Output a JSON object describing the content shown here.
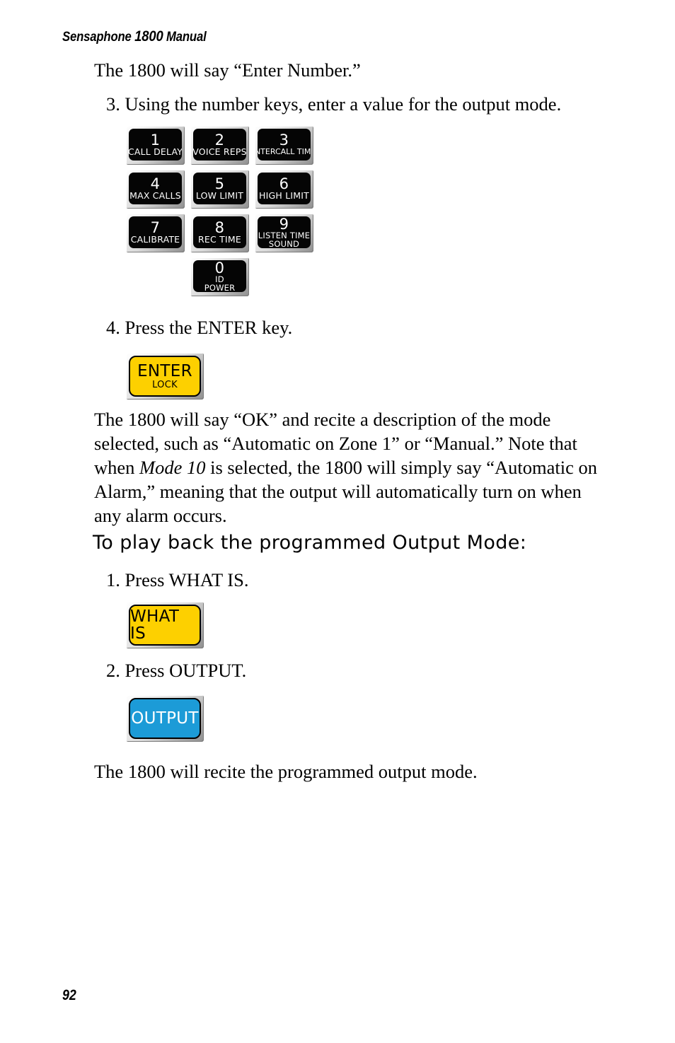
{
  "running_head": {
    "prefix": "Sensaphone ",
    "model": "1800",
    "suffix": " Manual"
  },
  "body": {
    "enter_number": "The 1800 will say “Enter Number.”",
    "step_3": "3. Using the number keys, enter a value for the output mode.",
    "step_4": "4. Press the ENTER key.",
    "ok_paragraph_part1": "The 1800 will say “OK” and recite a description of the mode selected, such as “Automatic on Zone 1” or “Manual.” Note that when ",
    "ok_paragraph_italic": "Mode 10",
    "ok_paragraph_part2": " is selected, the 1800 will simply say “Automatic on Alarm,” meaning that the output will automatically turn on when any alarm occurs.",
    "section_heading": "To play back the programmed Output Mode:",
    "step_1": "1. Press WHAT IS.",
    "step_2": "2. Press OUTPUT.",
    "recite_paragraph": "The 1800 will recite the programmed output mode."
  },
  "keypad": {
    "rows": [
      [
        {
          "digit": "1",
          "label": "CALL DELAY",
          "label2": ""
        },
        {
          "digit": "2",
          "label": "VOICE REPS",
          "label2": ""
        },
        {
          "digit": "3",
          "label": "INTERCALL TIME",
          "label2": ""
        }
      ],
      [
        {
          "digit": "4",
          "label": "MAX CALLS",
          "label2": ""
        },
        {
          "digit": "5",
          "label": "LOW LIMIT",
          "label2": ""
        },
        {
          "digit": "6",
          "label": "HIGH LIMIT",
          "label2": ""
        }
      ],
      [
        {
          "digit": "7",
          "label": "CALIBRATE",
          "label2": ""
        },
        {
          "digit": "8",
          "label": "REC TIME",
          "label2": ""
        },
        {
          "digit": "9",
          "label": "LISTEN TIME",
          "label2": "SOUND"
        }
      ]
    ],
    "zero_key": {
      "digit": "0",
      "label": "ID",
      "label2": "POWER"
    }
  },
  "function_buttons": {
    "enter": {
      "main": "ENTER",
      "sub": "LOCK",
      "face_color": "#FDD000",
      "text_color": "#000000"
    },
    "what_is": {
      "main": "WHAT IS",
      "sub": "",
      "face_color": "#FDD000",
      "text_color": "#000000"
    },
    "output": {
      "main": "OUTPUT",
      "sub": "",
      "face_color": "#1C9BD7",
      "text_color": "#FFFFFF"
    }
  },
  "page_number": "92"
}
